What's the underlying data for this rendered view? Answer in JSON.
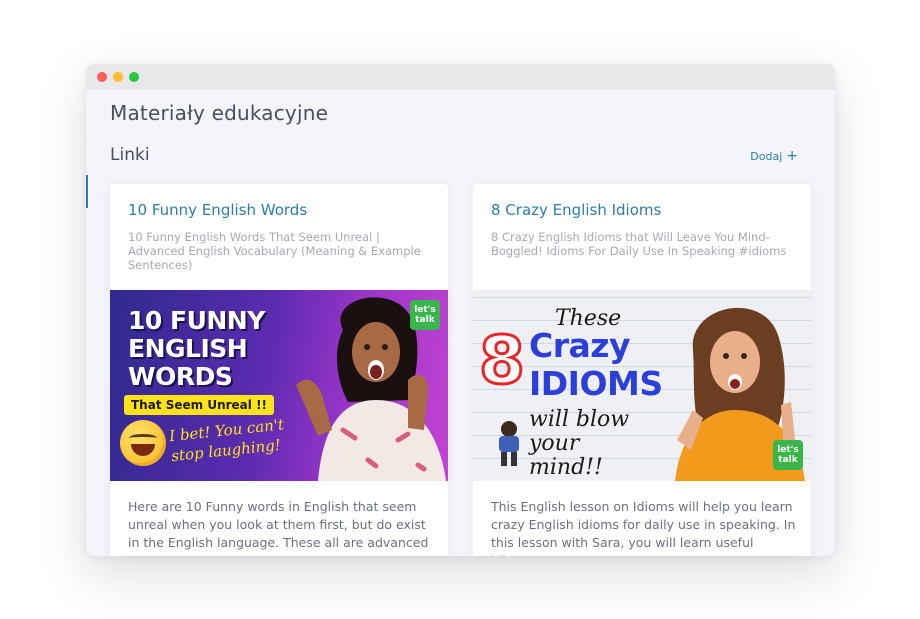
{
  "window": {
    "controls": [
      "close",
      "minimize",
      "maximize"
    ]
  },
  "page": {
    "title": "Materiały edukacyjne"
  },
  "section": {
    "title": "Linki",
    "add_label": "Dodaj",
    "add_icon": "+"
  },
  "cards": [
    {
      "title": "10 Funny English Words",
      "subtitle": "10 Funny English Words That Seem Unreal | Advanced English Vocabulary (Meaning & Example Sentences)",
      "description": "Here are 10 Funny words in English that seem unreal when you look at them first, but do exist in the English language. These all are advanced",
      "thumbnail": {
        "headline": "10 FUNNY ENGLISH WORDS",
        "banner": "That Seem Unreal !!",
        "tagline": "I bet! You can't stop laughing!",
        "badge": "let's talk"
      }
    },
    {
      "title": "8 Crazy English Idioms",
      "subtitle": "8 Crazy English Idioms that Will Leave You Mind-Boggled! Idioms For Daily Use In Speaking #idioms",
      "description": "This English lesson on Idioms will help you learn crazy English idioms for daily use in speaking. In this lesson with Sara, you will learn useful idioms",
      "thumbnail": {
        "these": "These",
        "number": "8",
        "line1": "Crazy",
        "line2": "IDIOMS",
        "tagline": "will blow your mind!!",
        "badge": "let's talk"
      }
    }
  ],
  "colors": {
    "accent": "#2e7ea8",
    "background": "#f4f5fa",
    "title": "#4a4e63"
  }
}
